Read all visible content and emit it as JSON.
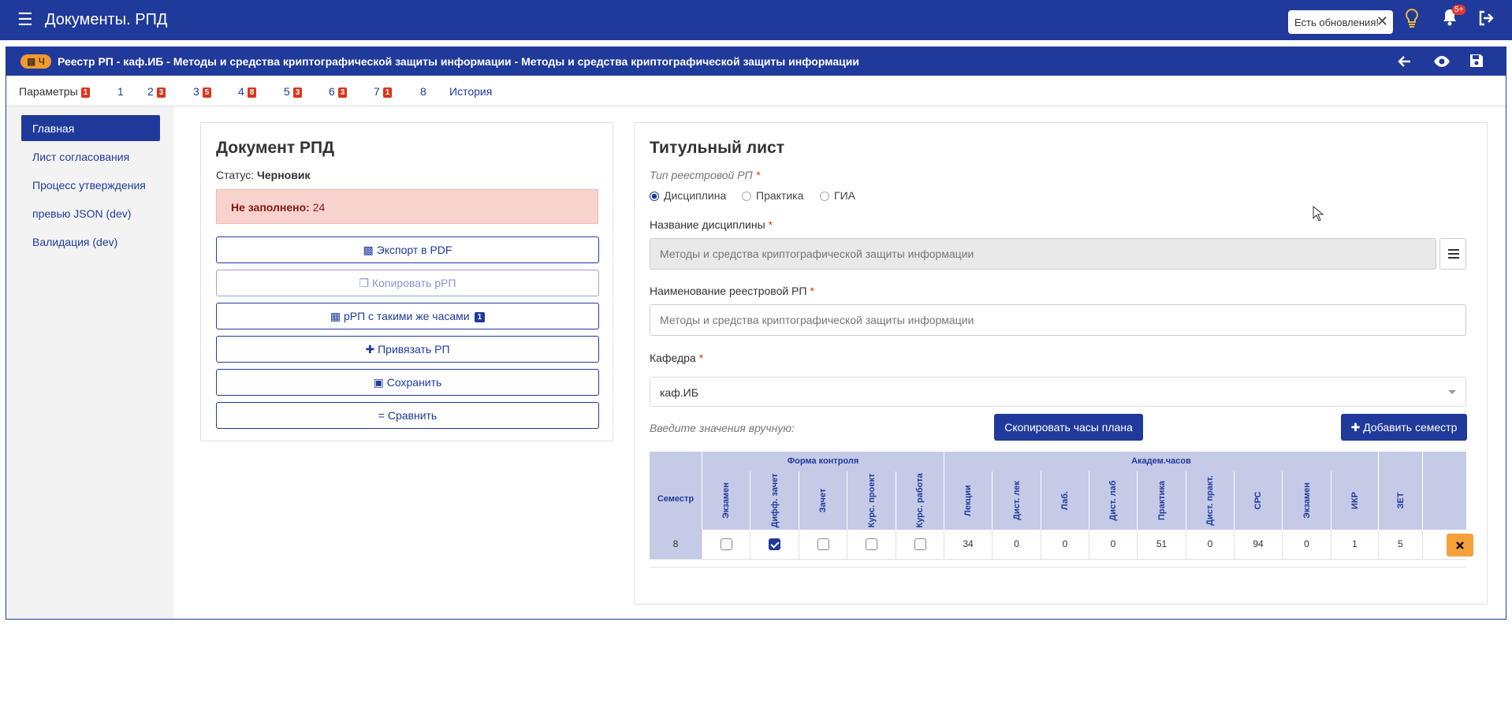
{
  "app": {
    "title": "Документы. РПД"
  },
  "header": {
    "update_notice": "Есть обновления!",
    "notif_count": "5+"
  },
  "doc": {
    "tag": "Ч",
    "title": "Реестр РП - каф.ИБ - Методы и средства криптографической защиты информации - Методы и средства криптографической защиты информации"
  },
  "tabs": [
    {
      "label": "Параметры",
      "count": "1"
    },
    {
      "label": "1",
      "count": ""
    },
    {
      "label": "2",
      "count": "3"
    },
    {
      "label": "3",
      "count": "5"
    },
    {
      "label": "4",
      "count": "8"
    },
    {
      "label": "5",
      "count": "3"
    },
    {
      "label": "6",
      "count": "3"
    },
    {
      "label": "7",
      "count": "1"
    },
    {
      "label": "8",
      "count": ""
    },
    {
      "label": "История",
      "count": ""
    }
  ],
  "sidebar": {
    "items": [
      "Главная",
      "Лист согласования",
      "Процесс утверждения",
      "превью JSON (dev)",
      "Валидация (dev)"
    ]
  },
  "left": {
    "title": "Документ РПД",
    "status_label": "Статус:",
    "status_value": "Черновик",
    "alert_label": "Не заполнено:",
    "alert_value": "24",
    "buttons": {
      "export": "Экспорт в PDF",
      "copy": "Копировать рРП",
      "same_hours": "рРП с такими же часами",
      "same_hours_count": "1",
      "link": "Привязать РП",
      "save": "Сохранить",
      "compare": "Сравнить"
    }
  },
  "right": {
    "title": "Титульный лист",
    "type_label": "Тип реестровой РП",
    "types": [
      "Дисциплина",
      "Практика",
      "ГИА"
    ],
    "discipline_label": "Название дисциплины",
    "discipline_value": "Методы и средства криптографической защиты информации",
    "registry_label": "Наименование реестровой РП",
    "registry_placeholder": "Методы и средства криптографической защиты информации",
    "dept_label": "Кафедра",
    "dept_value": "каф.ИБ",
    "manual_label": "Введите значения вручную:",
    "copy_hours_btn": "Скопировать часы плана",
    "add_sem_btn": "Добавить семестр"
  },
  "table": {
    "group_control": "Форма контроля",
    "group_hours": "Академ.часов",
    "semester_header": "Семестр",
    "control_cols": [
      "Экзамен",
      "Дифф. зачет",
      "Зачет",
      "Курс. проект",
      "Курс. работа"
    ],
    "hour_cols": [
      "Лекции",
      "Дист. лек",
      "Лаб.",
      "Дист. лаб",
      "Практика",
      "Дист. практ.",
      "СРС",
      "Экзамен",
      "ИКР",
      "ЗЕТ"
    ],
    "rows": [
      {
        "semester": "8",
        "control": [
          false,
          true,
          false,
          false,
          false
        ],
        "hours": [
          "34",
          "0",
          "0",
          "0",
          "51",
          "0",
          "94",
          "0",
          "1",
          "5"
        ]
      }
    ]
  }
}
